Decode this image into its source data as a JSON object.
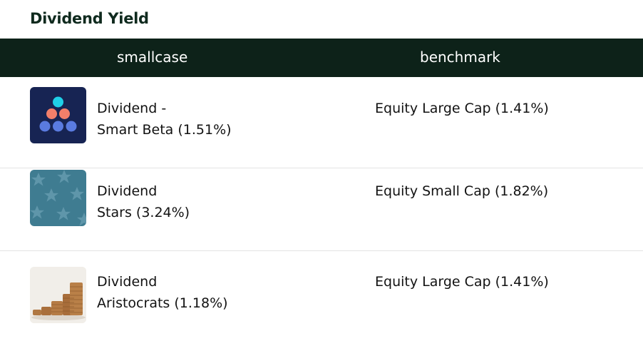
{
  "section": {
    "title": "Dividend Yield"
  },
  "table": {
    "headers": {
      "smallcase": "smallcase",
      "benchmark": "benchmark"
    },
    "rows": [
      {
        "name_line1": "Dividend -",
        "name_line2": "Smart Beta (1.51%)",
        "benchmark": "Equity Large Cap (1.41%)",
        "icon": "smart-beta-dots-icon"
      },
      {
        "name_line1": "Dividend",
        "name_line2": "Stars (3.24%)",
        "benchmark": "Equity Small Cap (1.82%)",
        "icon": "stars-pattern-icon"
      },
      {
        "name_line1": "Dividend",
        "name_line2": "Aristocrats (1.18%)",
        "benchmark": "Equity Large Cap (1.41%)",
        "icon": "coin-stacks-image"
      }
    ]
  },
  "colors": {
    "header_bg": "#0d2219",
    "title_text": "#0f2a1e",
    "smart_beta_bg": "#172453",
    "stars_bg": "#3f7c91"
  }
}
